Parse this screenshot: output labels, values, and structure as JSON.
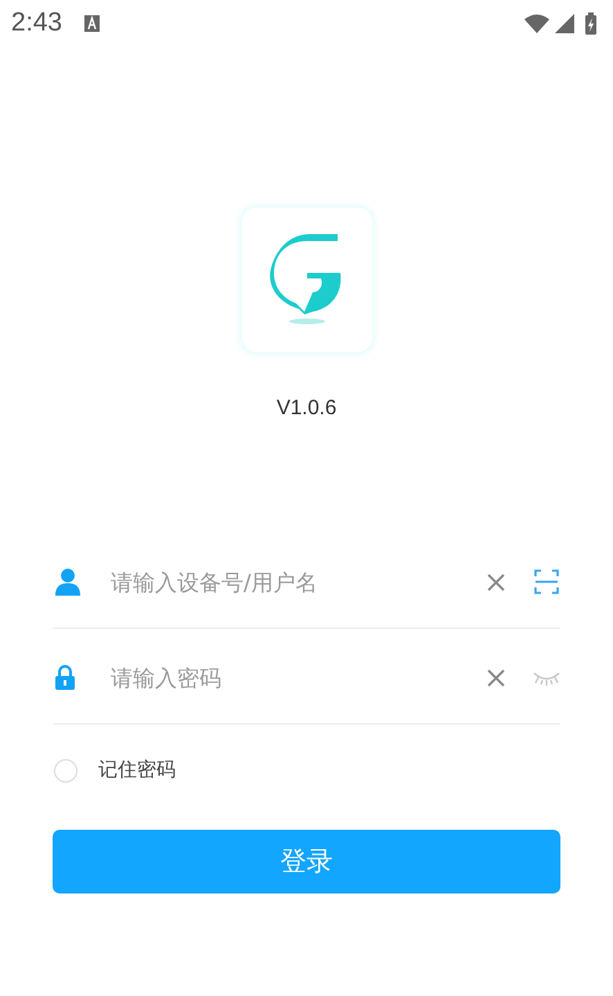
{
  "status_bar": {
    "time": "2:43"
  },
  "app": {
    "version": "V1.0.6"
  },
  "fields": [
    {
      "kind": "account",
      "placeholder": "请输入设备号/用户名"
    },
    {
      "kind": "password",
      "placeholder": "请输入密码"
    }
  ],
  "remember": {
    "label": "记住密码",
    "checked": false
  },
  "login_button": {
    "label": "登录"
  }
}
